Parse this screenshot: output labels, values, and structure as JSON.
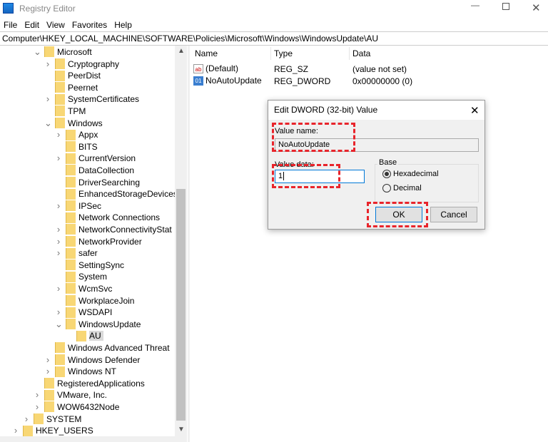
{
  "window": {
    "title": "Registry Editor",
    "icon": "registry-icon"
  },
  "menu": [
    "File",
    "Edit",
    "View",
    "Favorites",
    "Help"
  ],
  "address": "Computer\\HKEY_LOCAL_MACHINE\\SOFTWARE\\Policies\\Microsoft\\Windows\\WindowsUpdate\\AU",
  "tree": [
    {
      "label": "Microsoft",
      "level": 3,
      "exp": "open"
    },
    {
      "label": "Cryptography",
      "level": 4,
      "exp": "closed"
    },
    {
      "label": "PeerDist",
      "level": 4,
      "exp": "none"
    },
    {
      "label": "Peernet",
      "level": 4,
      "exp": "none"
    },
    {
      "label": "SystemCertificates",
      "level": 4,
      "exp": "closed"
    },
    {
      "label": "TPM",
      "level": 4,
      "exp": "none"
    },
    {
      "label": "Windows",
      "level": 4,
      "exp": "open"
    },
    {
      "label": "Appx",
      "level": 5,
      "exp": "closed"
    },
    {
      "label": "BITS",
      "level": 5,
      "exp": "none"
    },
    {
      "label": "CurrentVersion",
      "level": 5,
      "exp": "closed"
    },
    {
      "label": "DataCollection",
      "level": 5,
      "exp": "none"
    },
    {
      "label": "DriverSearching",
      "level": 5,
      "exp": "none"
    },
    {
      "label": "EnhancedStorageDevices",
      "level": 5,
      "exp": "none"
    },
    {
      "label": "IPSec",
      "level": 5,
      "exp": "closed"
    },
    {
      "label": "Network Connections",
      "level": 5,
      "exp": "none"
    },
    {
      "label": "NetworkConnectivityStat",
      "level": 5,
      "exp": "closed"
    },
    {
      "label": "NetworkProvider",
      "level": 5,
      "exp": "closed"
    },
    {
      "label": "safer",
      "level": 5,
      "exp": "closed"
    },
    {
      "label": "SettingSync",
      "level": 5,
      "exp": "none"
    },
    {
      "label": "System",
      "level": 5,
      "exp": "none"
    },
    {
      "label": "WcmSvc",
      "level": 5,
      "exp": "closed"
    },
    {
      "label": "WorkplaceJoin",
      "level": 5,
      "exp": "none"
    },
    {
      "label": "WSDAPI",
      "level": 5,
      "exp": "closed"
    },
    {
      "label": "WindowsUpdate",
      "level": 5,
      "exp": "open"
    },
    {
      "label": "AU",
      "level": 6,
      "exp": "none",
      "selected": true
    },
    {
      "label": "Windows Advanced Threat",
      "level": 4,
      "exp": "none"
    },
    {
      "label": "Windows Defender",
      "level": 4,
      "exp": "closed"
    },
    {
      "label": "Windows NT",
      "level": 4,
      "exp": "closed"
    },
    {
      "label": "RegisteredApplications",
      "level": 3,
      "exp": "none"
    },
    {
      "label": "VMware, Inc.",
      "level": 3,
      "exp": "closed"
    },
    {
      "label": "WOW6432Node",
      "level": 3,
      "exp": "closed"
    },
    {
      "label": "SYSTEM",
      "level": 2,
      "exp": "closed"
    },
    {
      "label": "HKEY_USERS",
      "level": 1,
      "exp": "closed"
    }
  ],
  "columns": {
    "name": "Name",
    "type": "Type",
    "data": "Data"
  },
  "values": [
    {
      "name": "(Default)",
      "type": "REG_SZ",
      "data": "(value not set)",
      "icon": "string-value-icon"
    },
    {
      "name": "NoAutoUpdate",
      "type": "REG_DWORD",
      "data": "0x00000000 (0)",
      "icon": "binary-value-icon"
    }
  ],
  "dialog": {
    "title": "Edit DWORD (32-bit) Value",
    "value_name_label": "Value name:",
    "value_name": "NoAutoUpdate",
    "value_data_label": "Value data:",
    "value_data": "1",
    "base_label": "Base",
    "hex_label": "Hexadecimal",
    "dec_label": "Decimal",
    "base_selected": "Hexadecimal",
    "ok": "OK",
    "cancel": "Cancel"
  },
  "colors": {
    "highlight": "#e8242b",
    "folder": "#f8d775",
    "focus": "#0078d7"
  }
}
